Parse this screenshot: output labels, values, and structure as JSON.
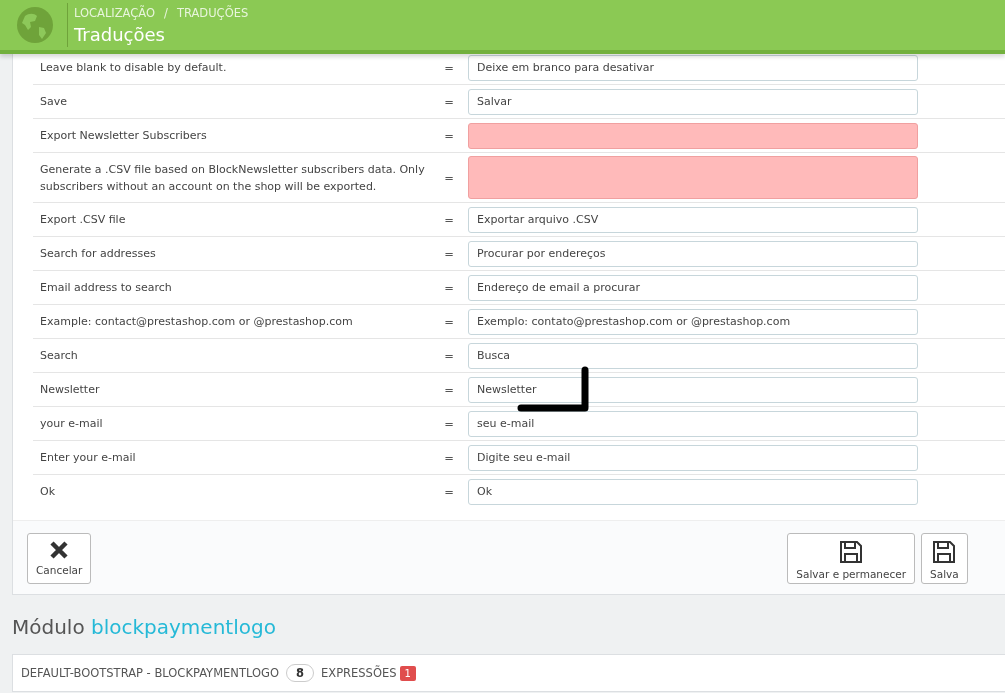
{
  "header": {
    "breadcrumb": [
      "LOCALIZAÇÃO",
      "TRADUÇÕES"
    ],
    "separator": "/",
    "title": "Traduções"
  },
  "rows": [
    {
      "source": "Leave blank to disable by default.",
      "equals": "=",
      "translation": "Deixe em branco para desativar",
      "missing": false
    },
    {
      "source": "Save",
      "equals": "=",
      "translation": "Salvar",
      "missing": false
    },
    {
      "source": "Export Newsletter Subscribers",
      "equals": "=",
      "missing": true
    },
    {
      "source": "Generate a .CSV file based on BlockNewsletter subscribers data. Only subscribers without an account on the shop will be exported.",
      "equals": "=",
      "missing": true
    },
    {
      "source": "Export .CSV file",
      "equals": "=",
      "translation": "Exportar arquivo .CSV",
      "missing": false
    },
    {
      "source": "Search for addresses",
      "equals": "=",
      "translation": "Procurar por endereços",
      "missing": false
    },
    {
      "source": "Email address to search",
      "equals": "=",
      "translation": "Endereço de email a procurar",
      "missing": false
    },
    {
      "source": "Example: contact@prestashop.com or @prestashop.com",
      "equals": "=",
      "translation": "Exemplo: contato@prestashop.com or @prestashop.com",
      "missing": false
    },
    {
      "source": "Search",
      "equals": "=",
      "translation": "Busca",
      "missing": false
    },
    {
      "source": "Newsletter",
      "equals": "=",
      "translation": "Newsletter",
      "missing": false
    },
    {
      "source": "your e-mail",
      "equals": "=",
      "translation": "seu e-mail",
      "missing": false
    },
    {
      "source": "Enter your e-mail",
      "equals": "=",
      "translation": "Digite seu e-mail",
      "missing": false
    },
    {
      "source": "Ok",
      "equals": "=",
      "translation": "Ok",
      "missing": false
    }
  ],
  "footer_buttons": [
    {
      "label": "Cancelar",
      "kind": "cancel"
    },
    {
      "label": "Salvar e permanecer",
      "kind": "save"
    },
    {
      "label": "Salva",
      "kind": "save"
    }
  ],
  "module": {
    "prefix": "Módulo",
    "name": "blockpaymentlogo",
    "panel_title": "DEFAULT-BOOTSTRAP - BLOCKPAYMENTLOGO",
    "count": "8",
    "count_label": "EXPRESSÕES",
    "missing_count": "1"
  }
}
